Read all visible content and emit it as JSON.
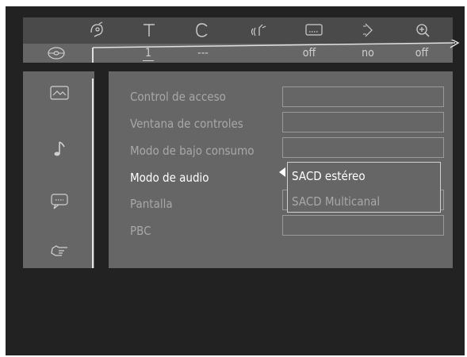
{
  "topbar": {
    "icons": [
      "disc-setup-icon",
      "title-icon",
      "chapter-icon",
      "audio-icon",
      "subtitle-icon",
      "angle-icon",
      "zoom-icon"
    ]
  },
  "statusbar": {
    "values": [
      "1",
      "---",
      "off",
      "no",
      "off"
    ]
  },
  "sidebar": {
    "items": [
      {
        "icon": "picture-icon"
      },
      {
        "icon": "music-note-icon"
      },
      {
        "icon": "speech-bubble-icon"
      },
      {
        "icon": "pointing-hand-icon"
      }
    ]
  },
  "menu": {
    "items": [
      "Control de acceso",
      "Ventana de controles",
      "Modo de bajo consumo",
      "Modo de audio",
      "Pantalla",
      "PBC"
    ],
    "active_index": 3
  },
  "dropdown": {
    "options": [
      "SACD estéreo",
      "SACD Multicanal"
    ],
    "selected_index": 0
  },
  "colors": {
    "background": "#222222",
    "panel": "#666666",
    "topbar": "#4a4a4a",
    "active_text": "#ffffff",
    "inactive_text": "#a8a8a8"
  }
}
